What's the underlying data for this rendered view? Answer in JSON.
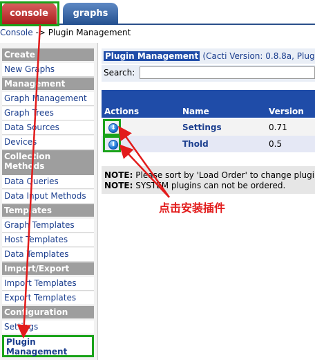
{
  "tabs": {
    "console_label": "console",
    "graphs_label": "graphs"
  },
  "breadcrumb": {
    "root": "Console",
    "separator": "->",
    "current": "Plugin Management"
  },
  "sidebar": {
    "sections": [
      {
        "head": "Create",
        "items": [
          "New Graphs"
        ]
      },
      {
        "head": "Management",
        "items": [
          "Graph Management",
          "Graph Trees",
          "Data Sources",
          "Devices"
        ]
      },
      {
        "head": "Collection Methods",
        "items": [
          "Data Queries",
          "Data Input Methods"
        ]
      },
      {
        "head": "Templates",
        "items": [
          "Graph Templates",
          "Host Templates",
          "Data Templates"
        ]
      },
      {
        "head": "Import/Export",
        "items": [
          "Import Templates",
          "Export Templates"
        ]
      },
      {
        "head": "Configuration",
        "items": [
          "Settings",
          "Plugin Management"
        ]
      }
    ]
  },
  "main": {
    "title_highlight": "Plugin Management",
    "title_rest": "(Cacti Version: 0.8.8a, Plug",
    "search_label": "Search:",
    "search_value": "",
    "columns": [
      "Actions",
      "Name",
      "Version"
    ],
    "rows": [
      {
        "name": "Settings",
        "version": "0.71",
        "action_icon": "install-icon"
      },
      {
        "name": "Thold",
        "version": "0.5",
        "action_icon": "install-icon"
      }
    ],
    "notes": [
      {
        "label": "NOTE:",
        "text": "Please sort by 'Load Order' to change plugi"
      },
      {
        "label": "NOTE:",
        "text": "SYSTEM plugins can not be ordered."
      }
    ]
  },
  "annotation": {
    "caption": "点击安装插件",
    "arrow_color": "#e21b1b",
    "highlight_color": "#1aa31a"
  },
  "colors": {
    "console_tab": "#a91d1c",
    "graphs_tab": "#24508f",
    "header_blue": "#1f4ca8",
    "nav_head": "#9e9e9e",
    "link_blue": "#1b3e8e"
  }
}
